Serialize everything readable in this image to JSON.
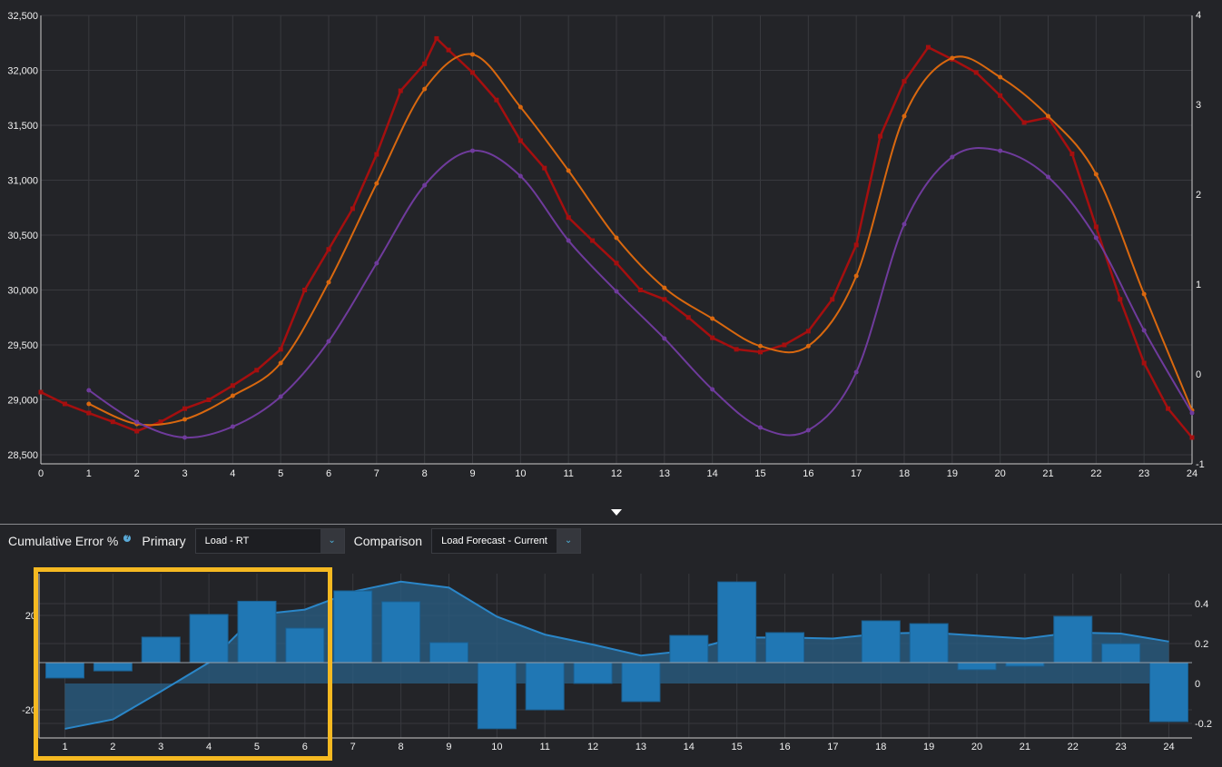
{
  "controls": {
    "title": "Cumulative Error %",
    "help_icon": "?",
    "primary_label": "Primary",
    "primary_value": "Load - RT",
    "comparison_label": "Comparison",
    "comparison_value": "Load Forecast - Current"
  },
  "colors": {
    "background": "#232428",
    "red": "#a50f0f",
    "orange": "#d9680f",
    "purple": "#6f3b9c",
    "bar": "#2077b4",
    "area": "#2a5f85",
    "highlight": "#f5b921"
  },
  "chart_data": [
    {
      "type": "line",
      "x_ticks": [
        "0",
        "1",
        "2",
        "3",
        "4",
        "5",
        "6",
        "7",
        "8",
        "9",
        "10",
        "11",
        "12",
        "13",
        "14",
        "15",
        "16",
        "17",
        "18",
        "19",
        "20",
        "21",
        "22",
        "23",
        "24"
      ],
      "xlim": [
        0,
        24
      ],
      "ylim": [
        28500,
        32500
      ],
      "y_ticks": [
        "28,500",
        "29,000",
        "29,500",
        "30,000",
        "30,500",
        "31,000",
        "31,500",
        "32,000",
        "32,500"
      ],
      "y2lim": [
        -1,
        4
      ],
      "y2_ticks": [
        "-1",
        "0",
        "1",
        "2",
        "3",
        "4"
      ],
      "grid": true,
      "series": [
        {
          "color": "#a50f0f",
          "x": [
            0,
            0.5,
            1,
            1.5,
            2,
            2.5,
            3,
            3.5,
            4,
            4.5,
            5,
            5.5,
            6,
            6.5,
            7,
            7.5,
            8,
            8.25,
            8.5,
            9,
            9.5,
            10,
            10.5,
            11,
            11.5,
            12,
            12.5,
            13,
            13.5,
            14,
            14.5,
            15,
            15.5,
            16,
            16.5,
            17,
            17.5,
            18,
            18.5,
            19,
            19.5,
            20,
            20.5,
            21,
            21.5,
            22,
            22.5,
            23,
            23.5,
            24
          ],
          "y": [
            29070,
            28963,
            28880,
            28800,
            28715,
            28800,
            28920,
            29000,
            29130,
            29270,
            29460,
            30000,
            30370,
            30740,
            31235,
            31814,
            32060,
            32290,
            32185,
            31980,
            31730,
            31360,
            31110,
            30660,
            30450,
            30245,
            30000,
            29915,
            29750,
            29565,
            29460,
            29435,
            29500,
            29625,
            29915,
            30410,
            31400,
            31900,
            32210,
            32100,
            31980,
            31770,
            31525,
            31570,
            31240,
            30575,
            29915,
            29335,
            28920,
            28657
          ]
        },
        {
          "color": "#d9680f",
          "x": [
            1,
            2,
            3,
            4,
            5,
            6,
            7,
            8,
            9,
            10,
            11,
            12,
            13,
            14,
            15,
            16,
            17,
            18,
            19,
            20,
            21,
            22,
            23,
            24
          ],
          "y": [
            28963,
            28780,
            28822,
            29037,
            29335,
            30070,
            30970,
            31830,
            32145,
            31665,
            31087,
            30475,
            30020,
            29740,
            29490,
            29490,
            30128,
            31583,
            32112,
            31938,
            31583,
            31054,
            29963,
            28905
          ]
        },
        {
          "color": "#6f3b9c",
          "x": [
            1,
            2,
            3,
            4,
            5,
            6,
            7,
            8,
            9,
            10,
            11,
            12,
            13,
            14,
            15,
            16,
            17,
            18,
            19,
            20,
            21,
            22,
            23,
            24
          ],
          "y": [
            29087,
            28798,
            28657,
            28756,
            29029,
            29533,
            30244,
            30954,
            31268,
            31037,
            30450,
            29988,
            29558,
            29095,
            28748,
            28723,
            29252,
            30599,
            31211,
            31268,
            31029,
            30475,
            29632,
            28880
          ]
        }
      ]
    },
    {
      "type": "bar",
      "categories": [
        "1",
        "2",
        "3",
        "4",
        "5",
        "6",
        "7",
        "8",
        "9",
        "10",
        "11",
        "12",
        "13",
        "14",
        "15",
        "16",
        "17",
        "18",
        "19",
        "20",
        "21",
        "22",
        "23",
        "24"
      ],
      "ylim": [
        -30,
        35
      ],
      "y_ticks": [
        "20",
        "-20"
      ],
      "y2_ticks": [
        "0.4",
        "0.2",
        "0",
        "-0.2"
      ],
      "grid": true,
      "series": [
        {
          "type": "bar",
          "axis": "left",
          "values": [
            -6.5,
            -3.5,
            10.8,
            20.4,
            26,
            14.6,
            30.4,
            25.8,
            8.5,
            -28,
            -20,
            -8.8,
            -16.5,
            11.5,
            34.2,
            12.7,
            0,
            17.7,
            16.5,
            -3,
            -1.5,
            19.6,
            8,
            -25
          ]
        },
        {
          "type": "area",
          "axis": "right",
          "values": [
            -0.227,
            -0.18,
            -0.04,
            0.105,
            0.345,
            0.37,
            0.46,
            0.51,
            0.48,
            0.335,
            0.245,
            0.195,
            0.14,
            0.165,
            0.23,
            0.23,
            0.225,
            0.25,
            0.255,
            0.24,
            0.225,
            0.255,
            0.25,
            0.21
          ]
        }
      ]
    }
  ]
}
